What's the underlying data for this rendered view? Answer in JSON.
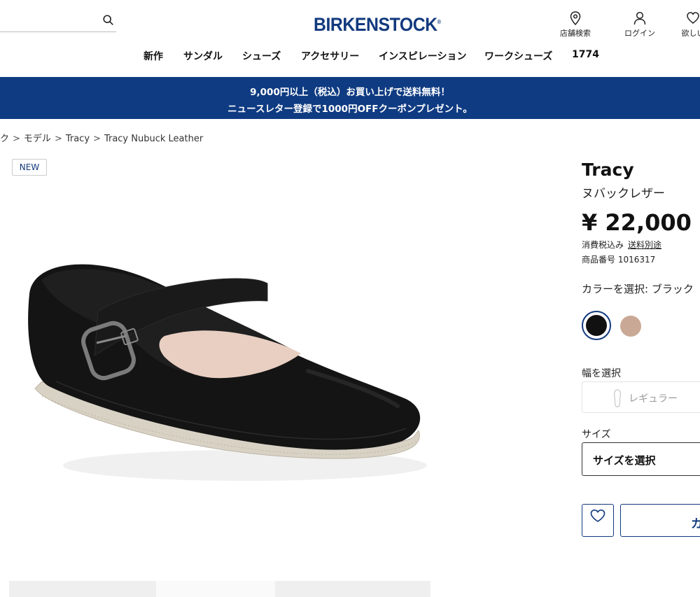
{
  "header": {
    "search": {
      "placeholder": "",
      "value": ""
    },
    "logo": "BIRKENSTOCK",
    "logo_mark": "®",
    "tools": {
      "store_search": "店舗検索",
      "login": "ログイン",
      "wishlist": "欲しい"
    }
  },
  "nav": {
    "items": [
      "新作",
      "サンダル",
      "シューズ",
      "アクセサリー",
      "インスピレーション",
      "ワークシューズ",
      "1774"
    ]
  },
  "promo": {
    "line1": "9,000円以上（税込）お買い上げで送料無料！",
    "line2": "ニュースレター登録で1000円OFFクーポンプレゼント。"
  },
  "breadcrumb": {
    "items": [
      "ク",
      "モデル",
      "Tracy",
      "Tracy Nubuck Leather"
    ],
    "separator": ">"
  },
  "badge": "NEW",
  "product": {
    "name": "Tracy",
    "subtitle": "ヌバックレザー",
    "price": "¥ 22,000",
    "tax_note": "消費税込み",
    "shipping_link": "送料別途",
    "code": "商品番号 1016317",
    "color_label": "カラーを選択: ブラック",
    "colors": [
      {
        "name": "black",
        "hex": "#111111",
        "selected": true
      },
      {
        "name": "taupe",
        "hex": "#c9a995",
        "selected": false
      }
    ],
    "width_label": "幅を選択",
    "width_option": "レギュラー",
    "size_label": "サイズ",
    "size_select": "サイズを選択",
    "cart_button": "カ"
  },
  "colors": {
    "brand_navy": "#123a7e",
    "promo_bg": "#0f3b82"
  }
}
